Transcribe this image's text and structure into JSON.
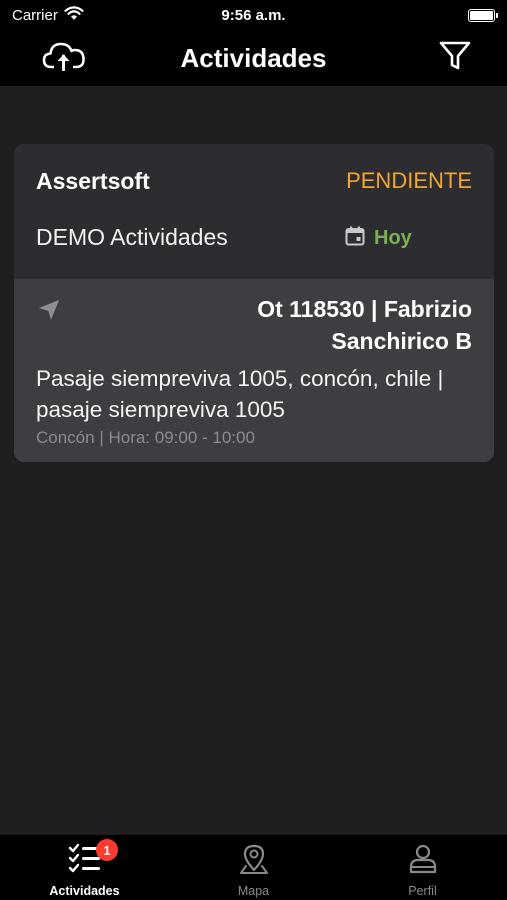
{
  "status_bar": {
    "carrier": "Carrier",
    "time": "9:56 a.m."
  },
  "nav": {
    "title": "Actividades",
    "left_icon": "cloud-upload-icon",
    "right_icon": "filter-icon"
  },
  "card": {
    "company": "Assertsoft",
    "status": "PENDIENTE",
    "status_color": "#f1a534",
    "activity": "DEMO Actividades",
    "date_label": "Hoy",
    "date_color": "#7ab055",
    "ot_title": "Ot 118530 | Fabrizio Sanchirico B",
    "address": "Pasaje siempreviva 1005, concón, chile | pasaje siempreviva 1005",
    "meta": "Concón | Hora: 09:00 - 10:00"
  },
  "tabs": [
    {
      "label": "Actividades",
      "icon": "checklist-icon",
      "badge": "1",
      "active": true
    },
    {
      "label": "Mapa",
      "icon": "map-pin-icon",
      "active": false
    },
    {
      "label": "Perfil",
      "icon": "person-icon",
      "active": false
    }
  ]
}
